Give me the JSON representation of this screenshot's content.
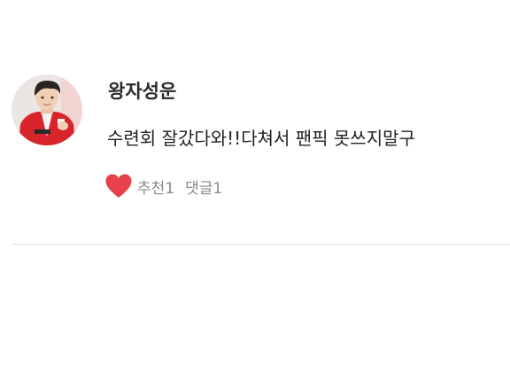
{
  "comment": {
    "author": "왕자성운",
    "text": "수련회 잘갔다와!!다쳐서 팬픽 못쓰지말구",
    "like_label": "추천1",
    "reply_label": "댓글1",
    "like_icon": "heart-icon",
    "like_color": "#e8414a"
  }
}
